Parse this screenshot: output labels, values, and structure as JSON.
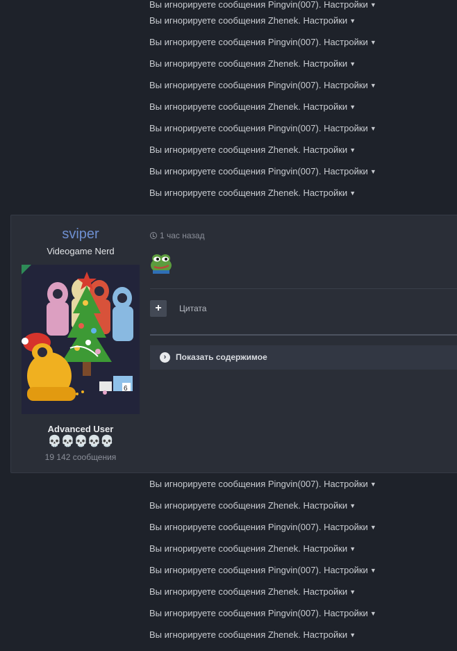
{
  "ignored_top": [
    {
      "text": "Вы игнорируете сообщения Pingvin(007). ",
      "settings": "Настройки"
    },
    {
      "text": "Вы игнорируете сообщения Zhenek. ",
      "settings": "Настройки"
    },
    {
      "text": "Вы игнорируете сообщения Pingvin(007). ",
      "settings": "Настройки"
    },
    {
      "text": "Вы игнорируете сообщения Zhenek. ",
      "settings": "Настройки"
    },
    {
      "text": "Вы игнорируете сообщения Pingvin(007). ",
      "settings": "Настройки"
    },
    {
      "text": "Вы игнорируете сообщения Zhenek. ",
      "settings": "Настройки"
    },
    {
      "text": "Вы игнорируете сообщения Pingvin(007). ",
      "settings": "Настройки"
    },
    {
      "text": "Вы игнорируете сообщения Zhenek. ",
      "settings": "Настройки"
    },
    {
      "text": "Вы игнорируете сообщения Pingvin(007). ",
      "settings": "Настройки"
    },
    {
      "text": "Вы игнорируете сообщения Zhenek. ",
      "settings": "Настройки"
    }
  ],
  "post": {
    "author": "sviper",
    "user_title": "Videogame Nerd",
    "group": "Advanced User",
    "rank_icons": "💀💀💀💀💀",
    "post_count": "19 142 сообщения",
    "time": "1 час назад",
    "quote_label": "Цитата",
    "quote_button": "+",
    "spoiler_icon": "›",
    "spoiler_label": "Показать содержимое"
  },
  "ignored_bottom": [
    {
      "text": "Вы игнорируете сообщения Pingvin(007). ",
      "settings": "Настройки"
    },
    {
      "text": "Вы игнорируете сообщения Zhenek. ",
      "settings": "Настройки"
    },
    {
      "text": "Вы игнорируете сообщения Pingvin(007). ",
      "settings": "Настройки"
    },
    {
      "text": "Вы игнорируете сообщения Zhenek. ",
      "settings": "Настройки"
    },
    {
      "text": "Вы игнорируете сообщения Pingvin(007). ",
      "settings": "Настройки"
    },
    {
      "text": "Вы игнорируете сообщения Zhenek. ",
      "settings": "Настройки"
    },
    {
      "text": "Вы игнорируете сообщения Pingvin(007). ",
      "settings": "Настройки"
    },
    {
      "text": "Вы игнорируете сообщения Zhenek. ",
      "settings": "Настройки"
    }
  ]
}
